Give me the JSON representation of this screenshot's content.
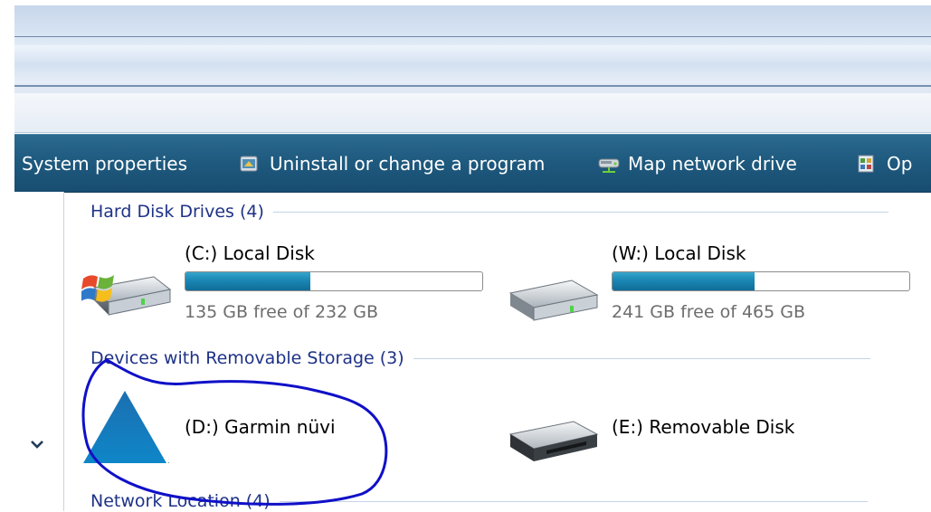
{
  "toolbar": {
    "items": [
      {
        "label": "System properties",
        "icon": "system-properties-icon"
      },
      {
        "label": "Uninstall or change a program",
        "icon": "uninstall-program-icon"
      },
      {
        "label": "Map network drive",
        "icon": "map-network-drive-icon"
      },
      {
        "label": "Op",
        "icon": "open-control-panel-icon"
      }
    ]
  },
  "groups": {
    "hard_disks": {
      "header": "Hard Disk Drives (4)",
      "drives": [
        {
          "name": "(C:) Local Disk",
          "free_text": "135 GB free of 232 GB",
          "used_fraction": 0.42,
          "icon": "windows-hard-drive-icon"
        },
        {
          "name": "(W:) Local Disk",
          "free_text": "241 GB free of 465 GB",
          "used_fraction": 0.48,
          "icon": "hard-drive-icon"
        }
      ]
    },
    "removable": {
      "header": "Devices with Removable Storage (3)",
      "drives": [
        {
          "name": "(D:) Garmin nüvi",
          "icon": "garmin-triangle-icon"
        },
        {
          "name": "(E:) Removable Disk",
          "icon": "removable-disk-icon"
        }
      ]
    },
    "network": {
      "header": "Network Location (4)"
    }
  },
  "colors": {
    "toolbar": "#1f5a7f",
    "group_header": "#1e3287",
    "bar_fill": "#1b86b3",
    "annotation": "#1010c8"
  }
}
